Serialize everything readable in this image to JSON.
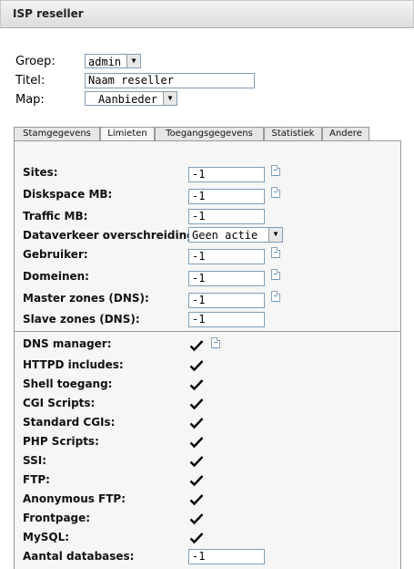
{
  "window": {
    "title": "ISP reseller"
  },
  "form": {
    "groep_label": "Groep:",
    "groep_value": "admin",
    "titel_label": "Titel:",
    "titel_value": "Naam reseller",
    "map_label": "Map:",
    "map_value": "Aanbieder"
  },
  "tabs": [
    "Stamgegevens",
    "Limieten",
    "Toegangsgegevens",
    "Statistiek",
    "Andere"
  ],
  "active_tab": "Limieten",
  "limits": [
    {
      "label": "Sites:",
      "value": "-1",
      "has_icon": true
    },
    {
      "label": "Diskspace MB:",
      "value": "-1",
      "has_icon": true
    },
    {
      "label": "Traffic MB:",
      "value": "-1",
      "has_icon": false
    },
    {
      "label": "Dataverkeer overschreiding:",
      "select": "Geen actie"
    },
    {
      "label": "Gebruiker:",
      "value": "-1",
      "has_icon": true
    },
    {
      "label": "Domeinen:",
      "value": "-1",
      "has_icon": true
    },
    {
      "label": "Master zones (DNS):",
      "value": "-1",
      "has_icon": true
    },
    {
      "label": "Slave zones (DNS):",
      "value": "-1",
      "has_icon": false
    }
  ],
  "features": [
    {
      "label": "DNS manager:",
      "checked": true,
      "has_icon": true
    },
    {
      "label": "HTTPD includes:",
      "checked": true
    },
    {
      "label": "Shell toegang:",
      "checked": true
    },
    {
      "label": "CGI Scripts:",
      "checked": true
    },
    {
      "label": "Standard CGIs:",
      "checked": true
    },
    {
      "label": "PHP Scripts:",
      "checked": true
    },
    {
      "label": "SSI:",
      "checked": true
    },
    {
      "label": "FTP:",
      "checked": true
    },
    {
      "label": "Anonymous FTP:",
      "checked": true
    },
    {
      "label": "Frontpage:",
      "checked": true
    },
    {
      "label": "MySQL:",
      "checked": true
    },
    {
      "label": "Aantal databases:",
      "value": "-1"
    }
  ]
}
